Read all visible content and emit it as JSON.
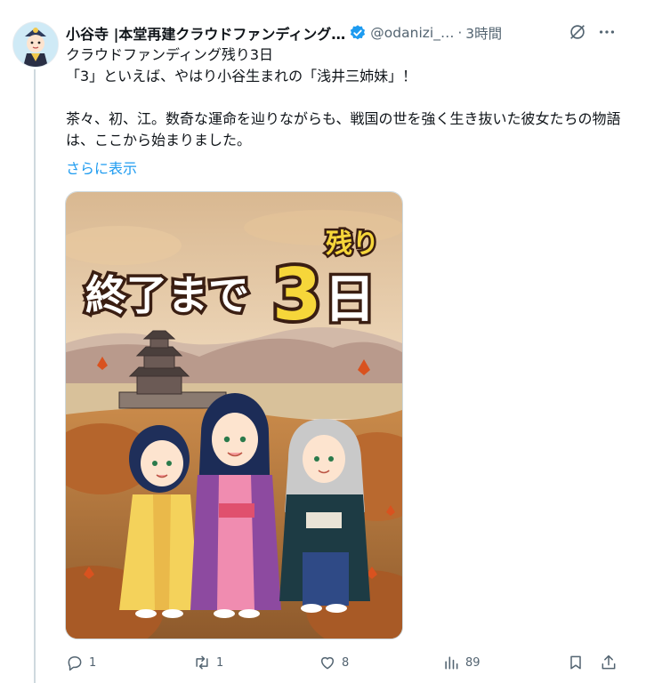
{
  "tweet": {
    "display_name": "小谷寺 |本堂再建クラウドファンディング…",
    "handle": "@odanizi_…",
    "separator": "·",
    "time": "3時間",
    "lines": [
      "クラウドファンディング残り3日",
      "「3」といえば、やはり小谷生まれの「浅井三姉妹」！"
    ],
    "paragraph": "茶々、初、江。数奇な運命を辿りながらも、戦国の世を強く生き抜いた彼女たちの物語は、ここから始まりました。",
    "show_more": "さらに表示",
    "image": {
      "headline": "終了まで",
      "number": "3",
      "unit": "日",
      "badge": "残り"
    }
  },
  "actions": {
    "reply_count": "1",
    "retweet_count": "1",
    "like_count": "8",
    "view_count": "89"
  },
  "icons": [
    "verified-badge-icon",
    "grok-icon",
    "more-icon",
    "reply-icon",
    "retweet-icon",
    "like-icon",
    "views-icon",
    "bookmark-icon",
    "share-icon"
  ],
  "colors": {
    "link": "#1d9bf0",
    "muted": "#536471",
    "verified": "#1d9bf0",
    "headline_yellow": "#f6d63a"
  }
}
